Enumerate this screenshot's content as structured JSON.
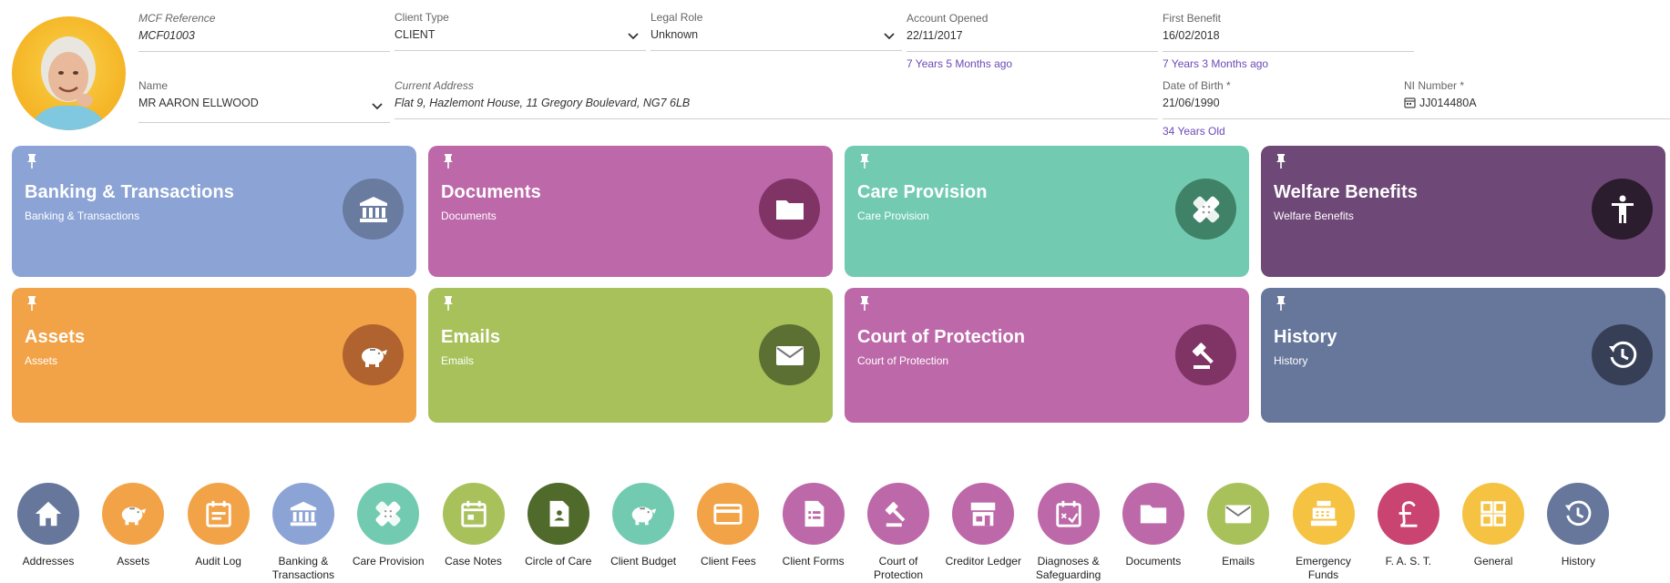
{
  "header": {
    "mcf_reference": {
      "label": "MCF Reference",
      "value": "MCF01003"
    },
    "client_type": {
      "label": "Client Type",
      "value": "CLIENT"
    },
    "legal_role": {
      "label": "Legal Role",
      "value": "Unknown"
    },
    "account_opened": {
      "label": "Account Opened",
      "value": "22/11/2017",
      "since": "7 Years 5 Months ago"
    },
    "first_benefit": {
      "label": "First Benefit",
      "value": "16/02/2018",
      "since": "7 Years 3 Months ago"
    },
    "name": {
      "label": "Name",
      "value": "MR AARON ELLWOOD"
    },
    "current_address": {
      "label": "Current Address",
      "value": "Flat 9, Hazlemont House, 11 Gregory Boulevard, NG7 6LB"
    },
    "date_of_birth": {
      "label": "Date of Birth *",
      "value": "21/06/1990",
      "age": "34 Years Old"
    },
    "ni_number": {
      "label": "NI Number *",
      "value": "JJ014480A"
    }
  },
  "tiles": [
    {
      "title": "Banking & Transactions",
      "subtitle": "Banking & Transactions",
      "icon": "bank-icon",
      "bg": "#8ba3d5",
      "circle": "#6a7ba0"
    },
    {
      "title": "Documents",
      "subtitle": "Documents",
      "icon": "folder-icon",
      "bg": "#bd68a9",
      "circle": "#803466"
    },
    {
      "title": "Care Provision",
      "subtitle": "Care Provision",
      "icon": "bandage-icon",
      "bg": "#72cbb1",
      "circle": "#3f8268"
    },
    {
      "title": "Welfare Benefits",
      "subtitle": "Welfare Benefits",
      "icon": "person-icon",
      "bg": "#6e4877",
      "circle": "#2b1d2d"
    },
    {
      "title": "Assets",
      "subtitle": "Assets",
      "icon": "piggy-bank-icon",
      "bg": "#f2a347",
      "circle": "#b0622f"
    },
    {
      "title": "Emails",
      "subtitle": "Emails",
      "icon": "envelope-icon",
      "bg": "#a8c15b",
      "circle": "#5c7034"
    },
    {
      "title": "Court of Protection",
      "subtitle": "Court of Protection",
      "icon": "gavel-icon",
      "bg": "#bd68a9",
      "circle": "#803466"
    },
    {
      "title": "History",
      "subtitle": "History",
      "icon": "history-icon",
      "bg": "#66779b",
      "circle": "#363f55"
    }
  ],
  "quick_links": [
    {
      "label": "Addresses",
      "icon": "home-icon",
      "color": "#66779b"
    },
    {
      "label": "Assets",
      "icon": "piggy-bank-icon",
      "color": "#f2a347"
    },
    {
      "label": "Audit Log",
      "icon": "calendar-list-icon",
      "color": "#f2a347"
    },
    {
      "label": "Banking & Transactions",
      "icon": "bank-icon",
      "color": "#8ba3d5"
    },
    {
      "label": "Care Provision",
      "icon": "bandage-icon",
      "color": "#72cbb1"
    },
    {
      "label": "Case Notes",
      "icon": "calendar-icon",
      "color": "#a8c15b"
    },
    {
      "label": "Circle of Care",
      "icon": "contact-file-icon",
      "color": "#4f6a2a"
    },
    {
      "label": "Client Budget",
      "icon": "piggy-bank-icon",
      "color": "#72cbb1"
    },
    {
      "label": "Client Fees",
      "icon": "credit-card-icon",
      "color": "#f2a347"
    },
    {
      "label": "Client Forms",
      "icon": "form-icon",
      "color": "#bd68a9"
    },
    {
      "label": "Court of Protection",
      "icon": "gavel-icon",
      "color": "#bd68a9"
    },
    {
      "label": "Creditor Ledger",
      "icon": "store-icon",
      "color": "#bd68a9"
    },
    {
      "label": "Diagnoses & Safeguarding",
      "icon": "calendar-check-icon",
      "color": "#bd68a9"
    },
    {
      "label": "Documents",
      "icon": "folder-icon",
      "color": "#bd68a9"
    },
    {
      "label": "Emails",
      "icon": "envelope-icon",
      "color": "#a8c15b"
    },
    {
      "label": "Emergency Funds",
      "icon": "cash-register-icon",
      "color": "#f5c242"
    },
    {
      "label": "F. A. S. T.",
      "icon": "pound-icon",
      "color": "#c94470"
    },
    {
      "label": "General",
      "icon": "grid-icon",
      "color": "#f5c242"
    },
    {
      "label": "History",
      "icon": "history-icon",
      "color": "#66779b"
    }
  ]
}
